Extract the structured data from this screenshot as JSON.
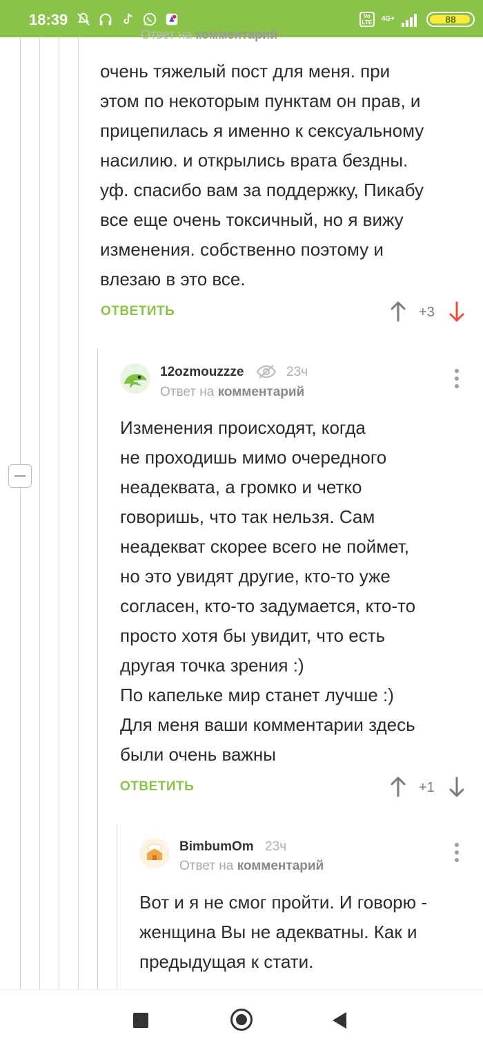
{
  "status_bar": {
    "time": "18:39",
    "battery": "88",
    "network": "4G+",
    "volte": "Vo LTE",
    "icons": [
      "mute-bell-icon",
      "headphones-icon",
      "tiktok-icon",
      "whatsapp-icon",
      "app-icon"
    ]
  },
  "colors": {
    "accent": "#8bc34a",
    "downvote_active": "#e84e3b",
    "text": "#2b2b2b"
  },
  "top_comment": {
    "faded_header_prefix": "Ответ на",
    "faded_header_link": "комментарий",
    "text_lines": [
      "очень тяжелый пост для меня. при",
      "этом по некоторым пунктам он прав, и",
      "прицепилась я именно к сексуальному",
      "насилию. и открылись врата бездны.",
      "уф. спасибо вам за поддержку, Пикабу",
      "все еще очень токсичный, но я вижу",
      "изменения. собственно поэтому и",
      "влезаю в это все."
    ],
    "reply_label": "ОТВЕТИТЬ",
    "rating": "+3"
  },
  "comment2": {
    "author": "12ozmouzzze",
    "time": "23ч",
    "reply_prefix": "Ответ на",
    "reply_link": "комментарий",
    "text_lines": [
      "Изменения происходят, когда",
      "не проходишь мимо очередного",
      "неадеквата, а громко и четко",
      "говоришь, что так нельзя. Сам",
      "неадекват скорее всего не поймет,",
      "но это увидят другие, кто-то уже",
      "согласен, кто-то задумается, кто-то",
      "просто хотя бы увидит, что есть",
      "другая точка зрения :)",
      "По капельке мир станет лучше :)",
      "Для меня ваши комментарии здесь",
      "были очень важны"
    ],
    "reply_label": "ОТВЕТИТЬ",
    "rating": "+1"
  },
  "comment3": {
    "author": "BimbumOm",
    "time": "23ч",
    "reply_prefix": "Ответ на",
    "reply_link": "комментарий",
    "text_lines": [
      "Вот и я не смог пройти. И говорю -",
      "женщина Вы не адекватны. Как и",
      "предыдущая к стати."
    ]
  }
}
